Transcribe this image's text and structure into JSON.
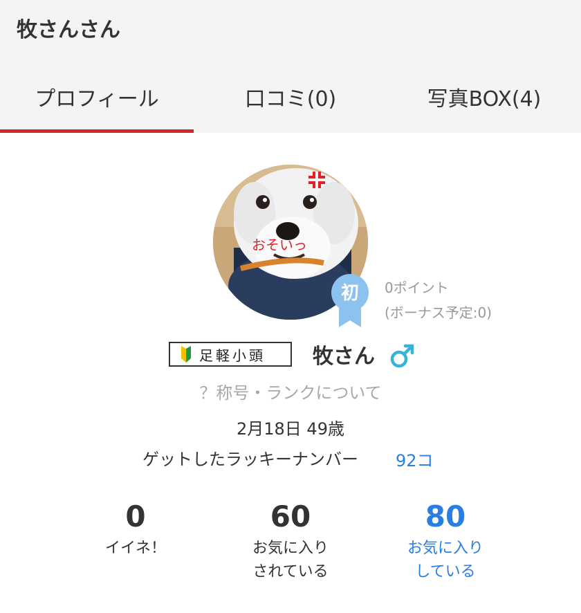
{
  "page": {
    "title": "牧さんさん"
  },
  "tabs": [
    {
      "label": "プロフィール",
      "active": true
    },
    {
      "label": "口コミ(0)",
      "active": false
    },
    {
      "label": "写真BOX(4)",
      "active": false
    }
  ],
  "profile": {
    "avatar_caption": "おそいっ",
    "badge_label": "初",
    "points": "0ポイント",
    "bonus": "(ボーナス予定:0)",
    "rank": "足軽小頭",
    "name": "牧さん",
    "gender_icon": "male-icon",
    "title_link": "？称号・ランクについて",
    "birthday": "2月18日 49歳",
    "lucky_label": "ゲットしたラッキーナンバー",
    "lucky_count": "92コ"
  },
  "stats": [
    {
      "value": "0",
      "label1": "イイネ！",
      "label2": ""
    },
    {
      "value": "60",
      "label1": "お気に入り",
      "label2": "されている"
    },
    {
      "value": "80",
      "label1": "お気に入り",
      "label2": "している"
    }
  ],
  "colors": {
    "accent": "#d0262a",
    "link": "#2a7de1",
    "badge": "#8ec2ee"
  }
}
